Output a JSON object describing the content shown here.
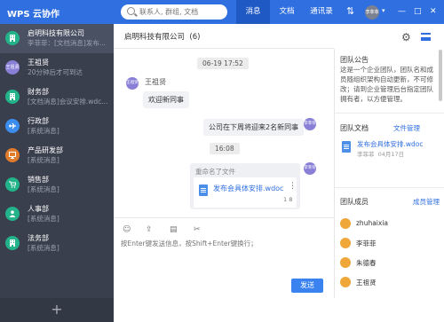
{
  "app": {
    "title": "WPS 云协作"
  },
  "search": {
    "placeholder": "联系人, 群组, 文档"
  },
  "nav": [
    {
      "label": "消息",
      "active": true
    },
    {
      "label": "文档"
    },
    {
      "label": "通讯录"
    }
  ],
  "user": {
    "avatar_text": "李菲菲"
  },
  "window_controls": {
    "minimize": "—",
    "maximize": "□",
    "close": "✕"
  },
  "conversations": [
    {
      "name": "启明科技有限公司",
      "msg": "李菲菲：[文档消息]发布...",
      "avatar_color": "#23b38a",
      "icon": "building-icon",
      "active": true
    },
    {
      "name": "王祖贤",
      "msg": "20分钟后才可到达",
      "avatar_color": "#8a7fd6",
      "avatar_text": "王祖贤"
    },
    {
      "name": "财务部",
      "msg": "[文档消息]会议安排.wdc...",
      "avatar_color": "#23b38a",
      "icon": "building-icon"
    },
    {
      "name": "行政部",
      "msg": "[系统消息]",
      "avatar_color": "#3c8df0",
      "icon": "plane-icon"
    },
    {
      "name": "产品研发部",
      "msg": "[系统消息]",
      "avatar_color": "#e07b2c",
      "icon": "monitor-icon"
    },
    {
      "name": "销售部",
      "msg": "[系统消息]",
      "avatar_color": "#23b38a",
      "icon": "cart-icon"
    },
    {
      "name": "人事部",
      "msg": "[系统消息]",
      "avatar_color": "#23b38a",
      "icon": "people-icon"
    },
    {
      "name": "法务部",
      "msg": "[系统消息]",
      "avatar_color": "#23b38a",
      "icon": "building-icon"
    }
  ],
  "sidebar_footer": {
    "add_label": "+"
  },
  "chat": {
    "title": "启明科技有限公司",
    "count": "(6)",
    "messages": {
      "time1": "06-19 17:52",
      "sender1": "王祖贤",
      "sender1_avatar": "王祖贤",
      "msg1": "欢迎新同事",
      "msg2": "公司在下周将迎来2名新同事",
      "self_avatar": "李菲菲",
      "time2": "16:08",
      "file_header": "重命名了文件",
      "file_name": "发布会具体安排.wdoc",
      "file_count": "1 8"
    },
    "composer_placeholder": "按Enter键发送信息，按Shift+Enter键换行；",
    "send_label": "发送"
  },
  "team": {
    "intro_title": "团队公告",
    "intro_text": "这是一个企业团队，团队名和成员随组织架构自动更新，不可修改；请到企业管理后台指定团队拥有者，以方便管理。",
    "docs_title": "团队文档",
    "docs_link": "文件管理",
    "doc_name": "发布会具体安排.wdoc",
    "doc_owner": "李菲菲",
    "doc_date": "04月17日",
    "members_title": "团队成员",
    "members_link": "成员管理",
    "members": [
      "zhuhaixia",
      "李菲菲",
      "朱德春",
      "王祖贤"
    ]
  },
  "colors": {
    "accent": "#2f6fe0",
    "sidebar": "#3a3f4d",
    "avatar_green": "#23b38a"
  }
}
